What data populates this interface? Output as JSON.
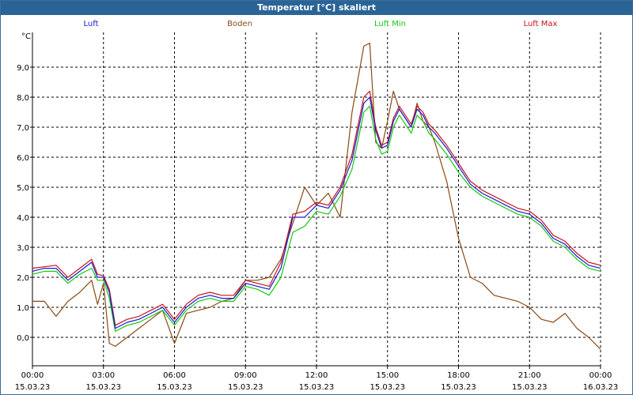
{
  "window": {
    "title": "Temperatur [°C] skaliert"
  },
  "legend": [
    {
      "name": "Luft",
      "color": "#1a1ad0"
    },
    {
      "name": "Boden",
      "color": "#8b4a13"
    },
    {
      "name": "Luft Min",
      "color": "#14c814"
    },
    {
      "name": "Luft Max",
      "color": "#c8141e"
    }
  ],
  "chart_data": {
    "type": "line",
    "ylabel": "°C",
    "ylim": [
      -0.5,
      10.0
    ],
    "yticks": [
      0.0,
      1.0,
      2.0,
      3.0,
      4.0,
      5.0,
      6.0,
      7.0,
      8.0,
      9.0
    ],
    "ytick_labels": [
      "0,0",
      "1,0",
      "2,0",
      "3,0",
      "4,0",
      "5,0",
      "6,0",
      "7,0",
      "8,0",
      "9,0"
    ],
    "xlim": [
      0,
      24
    ],
    "xticks": [
      0,
      3,
      6,
      9,
      12,
      15,
      18,
      21,
      24
    ],
    "xtick_labels": [
      [
        "00:00",
        "15.03.23"
      ],
      [
        "03:00",
        "15.03.23"
      ],
      [
        "06:00",
        "15.03.23"
      ],
      [
        "09:00",
        "15.03.23"
      ],
      [
        "12:00",
        "15.03.23"
      ],
      [
        "15:00",
        "15.03.23"
      ],
      [
        "18:00",
        "15.03.23"
      ],
      [
        "21:00",
        "15.03.23"
      ],
      [
        "00:00",
        "16.03.23"
      ]
    ],
    "grid": true,
    "legend_position": "top",
    "x": [
      0,
      0.5,
      1.0,
      1.5,
      2.0,
      2.5,
      2.75,
      3.0,
      3.25,
      3.5,
      4.0,
      4.5,
      5.0,
      5.5,
      6.0,
      6.5,
      7.0,
      7.5,
      8.0,
      8.5,
      9.0,
      9.5,
      10.0,
      10.5,
      11.0,
      11.5,
      12.0,
      12.5,
      13.0,
      13.5,
      14.0,
      14.25,
      14.5,
      14.75,
      15.0,
      15.25,
      15.5,
      15.75,
      16.0,
      16.25,
      16.5,
      16.75,
      17.0,
      17.5,
      18.0,
      18.5,
      19.0,
      19.5,
      20.0,
      20.5,
      21.0,
      21.5,
      22.0,
      22.5,
      23.0,
      23.5,
      24.0
    ],
    "series": [
      {
        "name": "Luft",
        "values": [
          2.2,
          2.3,
          2.3,
          1.9,
          2.2,
          2.5,
          2.0,
          2.0,
          1.5,
          0.3,
          0.5,
          0.6,
          0.8,
          1.0,
          0.5,
          1.0,
          1.3,
          1.4,
          1.3,
          1.3,
          1.8,
          1.7,
          1.6,
          2.3,
          4.0,
          4.0,
          4.4,
          4.3,
          4.9,
          5.9,
          7.8,
          8.0,
          6.9,
          6.3,
          6.4,
          7.2,
          7.6,
          7.3,
          7.0,
          7.6,
          7.4,
          7.0,
          6.8,
          6.3,
          5.7,
          5.1,
          4.8,
          4.6,
          4.4,
          4.2,
          4.1,
          3.8,
          3.3,
          3.1,
          2.7,
          2.4,
          2.3
        ]
      },
      {
        "name": "Boden",
        "values": [
          1.2,
          1.2,
          0.7,
          1.2,
          1.5,
          1.9,
          1.1,
          1.8,
          -0.2,
          -0.3,
          0.0,
          0.3,
          0.6,
          0.9,
          -0.2,
          0.8,
          0.9,
          1.0,
          1.2,
          1.3,
          1.9,
          1.9,
          2.0,
          2.6,
          3.8,
          5.0,
          4.4,
          4.8,
          4.0,
          7.5,
          9.7,
          9.8,
          6.5,
          6.3,
          7.2,
          8.2,
          7.6,
          7.3,
          7.0,
          7.8,
          7.2,
          7.0,
          6.5,
          5.2,
          3.3,
          2.0,
          1.8,
          1.4,
          1.3,
          1.2,
          1.0,
          0.6,
          0.5,
          0.8,
          0.3,
          0.0,
          -0.4
        ]
      },
      {
        "name": "Luft Min",
        "values": [
          2.1,
          2.2,
          2.2,
          1.8,
          2.1,
          2.3,
          1.9,
          1.9,
          1.3,
          0.2,
          0.4,
          0.5,
          0.7,
          0.9,
          0.4,
          0.9,
          1.2,
          1.3,
          1.2,
          1.2,
          1.7,
          1.6,
          1.4,
          2.0,
          3.5,
          3.7,
          4.2,
          4.1,
          4.7,
          5.6,
          7.5,
          7.7,
          6.6,
          6.1,
          6.2,
          7.0,
          7.4,
          7.1,
          6.8,
          7.4,
          7.2,
          6.8,
          6.6,
          6.1,
          5.5,
          5.0,
          4.7,
          4.5,
          4.3,
          4.1,
          4.0,
          3.7,
          3.2,
          3.0,
          2.6,
          2.3,
          2.2
        ]
      },
      {
        "name": "Luft Max",
        "values": [
          2.3,
          2.35,
          2.4,
          2.0,
          2.3,
          2.6,
          2.1,
          2.05,
          1.6,
          0.4,
          0.6,
          0.7,
          0.9,
          1.1,
          0.6,
          1.1,
          1.4,
          1.5,
          1.4,
          1.4,
          1.9,
          1.8,
          1.7,
          2.5,
          4.1,
          4.2,
          4.5,
          4.4,
          5.0,
          6.1,
          8.0,
          8.2,
          7.0,
          6.4,
          6.5,
          7.3,
          7.7,
          7.4,
          7.1,
          7.7,
          7.5,
          7.1,
          6.9,
          6.4,
          5.8,
          5.2,
          4.9,
          4.7,
          4.5,
          4.3,
          4.2,
          3.9,
          3.4,
          3.2,
          2.8,
          2.5,
          2.4
        ]
      }
    ]
  }
}
